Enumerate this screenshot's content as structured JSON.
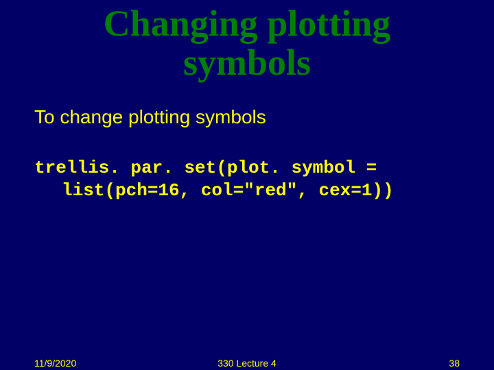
{
  "title_line1": "Changing plotting",
  "title_line2": "symbols",
  "intro": "To change plotting symbols",
  "code_line1": "trellis. par. set(plot. symbol =",
  "code_line2": "list(pch=16, col=\"red\", cex=1))",
  "footer": {
    "date": "11/9/2020",
    "center": "330 Lecture 4",
    "page": "38"
  }
}
